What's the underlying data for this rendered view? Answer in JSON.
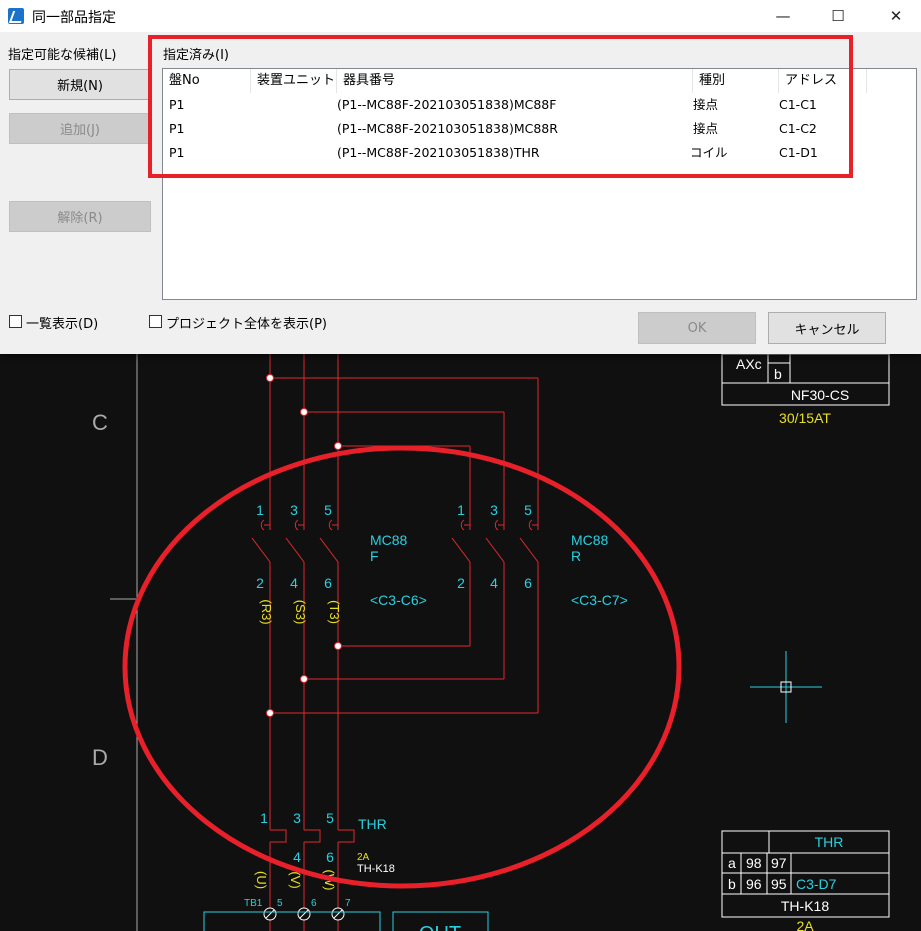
{
  "dialog": {
    "title": "同一部品指定",
    "window_buttons": {
      "minimize": "—",
      "maximize": "☐",
      "close": "✕"
    },
    "candidates_label": "指定可能な候補(L)",
    "assigned_label": "指定済み(I)",
    "buttons": {
      "new": "新規(N)",
      "add": "追加(J)",
      "release": "解除(R)",
      "ok": "OK",
      "cancel": "キャンセル"
    },
    "columns": [
      "盤No",
      "装置ユニット",
      "器具番号",
      "種別",
      "アドレス"
    ],
    "rows": [
      {
        "panel": "P1",
        "unit": "",
        "device": "(P1--MC88F-20210305183​8)MC88F",
        "kind": "接点",
        "address": "C1-C1"
      },
      {
        "panel": "P1",
        "unit": "",
        "device": "(P1--MC88F-20210305183​8)MC88R",
        "kind": "接点",
        "address": "C1-C2"
      },
      {
        "panel": "P1",
        "unit": "",
        "device": "(P1--MC88F-20210305183​8)THR",
        "kind": "コイル",
        "address": "C1-D1"
      }
    ],
    "checkbox_list": "一覧表示(D)",
    "checkbox_project": "プロジェクト全体を表示(P)"
  },
  "drawing": {
    "row_labels": [
      "C",
      "D"
    ],
    "mc88f": {
      "name1": "MC88",
      "name2": "F",
      "ref": "<C3-C6>"
    },
    "mc88r": {
      "name1": "MC88",
      "name2": "R",
      "ref": "<C3-C7>"
    },
    "top_terms": [
      "1",
      "3",
      "5"
    ],
    "bot_terms": [
      "2",
      "4",
      "6"
    ],
    "phase_labels": [
      "(R3)",
      "(S3)",
      "(T3)"
    ],
    "thr": {
      "name": "THR",
      "rating": "2A",
      "model": "TH-K18"
    },
    "out_labels": [
      "(U)",
      "(V)",
      "(W)"
    ],
    "tb": {
      "name": "TB1",
      "terms": [
        "5",
        "6",
        "7"
      ]
    },
    "out_box": "OUT",
    "breaker_table": {
      "axc": "AXc",
      "b": "b",
      "model": "NF30-CS",
      "rating": "30/15AT"
    },
    "thr_table": {
      "title": "THR",
      "row_a": [
        "a",
        "98",
        "97"
      ],
      "row_b": [
        "b",
        "96",
        "95",
        "C3-D7"
      ],
      "model": "TH-K18",
      "rating": "2A"
    }
  },
  "colors": {
    "wire": "#e0282e",
    "cyan": "#2ad0e0",
    "yellow": "#e8e020",
    "white": "#ffffff",
    "highlight": "#e8202a"
  }
}
